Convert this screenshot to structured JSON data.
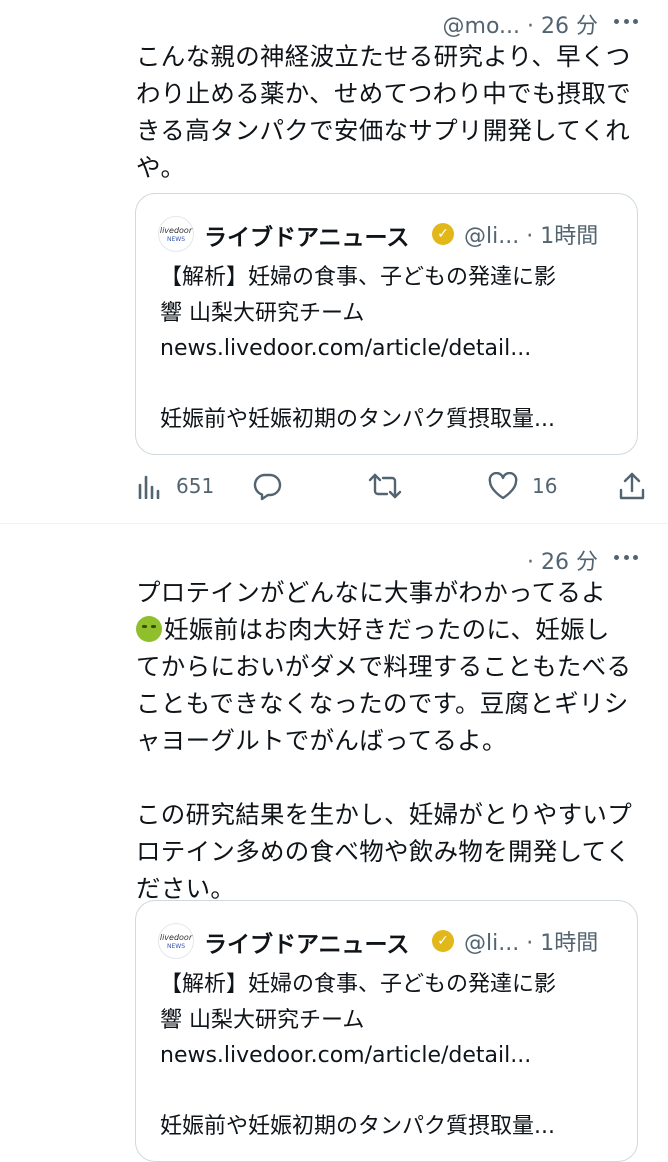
{
  "posts": [
    {
      "handle": "@mo...",
      "time": "· 26 分",
      "text": "こんな親の神経波立たせる研究より、早くつ\nわり止める薬か、せめてつわり中でも摂取で\nきる高タンパクで安価なサプリ開発してくれ\nや。",
      "quote": {
        "logo_text_top": "livedoor",
        "logo_text_bottom": "NEWS",
        "name": "ライブドアニュース",
        "handle": "@li...",
        "time": "· 1時間",
        "body": "【解析】妊婦の食事、子どもの発達に影\n響 山梨大研究チーム\nnews.livedoor.com/article/detail...\n\n妊娠前や妊娠初期のタンパク質摂取量..."
      },
      "stats": {
        "views": "651",
        "likes": "16"
      }
    },
    {
      "time": "· 26 分",
      "text_before_emoji": "プロテインがどんなに大事がわかってるよ\n",
      "text_after_emoji": "妊娠前はお肉大好きだったのに、妊娠し\nてからにおいがダメで料理することもたべる\nこともできなくなったのです。豆腐とギリシ\nャヨーグルトでがんばってるよ。\n\nこの研究結果を生かし、妊婦がとりやすいプ\nロテイン多めの食べ物や飲み物を開発してく\nださい。",
      "quote": {
        "logo_text_top": "livedoor",
        "logo_text_bottom": "NEWS",
        "name": "ライブドアニュース",
        "handle": "@li...",
        "time": "· 1時間",
        "body": "【解析】妊婦の食事、子どもの発達に影\n響 山梨大研究チーム\nnews.livedoor.com/article/detail...\n\n妊娠前や妊娠初期のタンパク質摂取量..."
      }
    }
  ],
  "colors": {
    "muted": "#536471",
    "border": "#cfd9de",
    "verified": "#e2b719"
  },
  "icons": [
    "more-icon",
    "verified-badge-icon",
    "views-icon",
    "reply-icon",
    "repost-icon",
    "like-icon",
    "share-icon",
    "nauseated-face-emoji"
  ]
}
